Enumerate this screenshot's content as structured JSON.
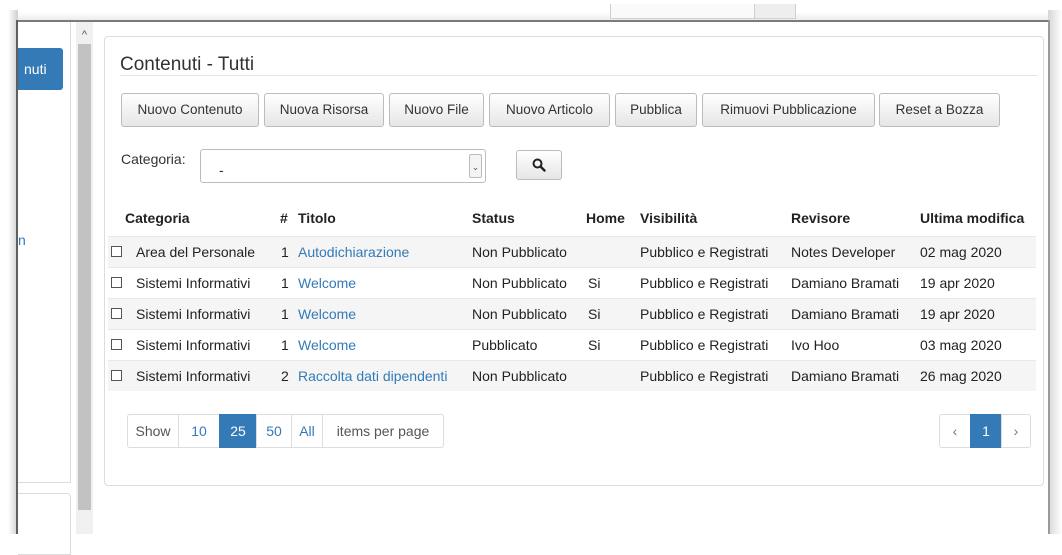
{
  "sidebar": {
    "active_item": "nuti",
    "link_fragment": "n"
  },
  "page": {
    "title": "Contenuti - Tutti"
  },
  "toolbar": {
    "buttons": [
      "Nuovo Contenuto",
      "Nuova Risorsa",
      "Nuovo File",
      "Nuovo Articolo",
      "Pubblica",
      "Rimuovi Pubblicazione",
      "Reset a Bozza"
    ]
  },
  "filter": {
    "label": "Categoria:",
    "selected": "-",
    "search_icon": "search-icon"
  },
  "table": {
    "headers": [
      "Categoria",
      "#",
      "Titolo",
      "Status",
      "Home",
      "Visibilità",
      "Revisore",
      "Ultima modifica"
    ],
    "rows": [
      [
        "Area del Personale",
        "1",
        "Autodichiarazione",
        "Non Pubblicato",
        "",
        "Pubblico e Registrati",
        "Notes Developer",
        "02 mag 2020"
      ],
      [
        "Sistemi Informativi",
        "1",
        "Welcome",
        "Non Pubblicato",
        "Si",
        "Pubblico e Registrati",
        "Damiano Bramati",
        "19 apr 2020"
      ],
      [
        "Sistemi Informativi",
        "1",
        "Welcome",
        "Non Pubblicato",
        "Si",
        "Pubblico e Registrati",
        "Damiano Bramati",
        "19 apr 2020"
      ],
      [
        "Sistemi Informativi",
        "1",
        "Welcome",
        "Pubblicato",
        "Si",
        "Pubblico e Registrati",
        "Ivo Hoo",
        "03 mag 2020"
      ],
      [
        "Sistemi Informativi",
        "2",
        "Raccolta dati dipendenti",
        "Non Pubblicato",
        "",
        "Pubblico e Registrati",
        "Damiano Bramati",
        "26 mag 2020"
      ]
    ]
  },
  "page_size": {
    "show_label": "Show",
    "options": [
      "10",
      "25",
      "50",
      "All"
    ],
    "selected": "25",
    "suffix": "items per page"
  },
  "pagination": {
    "prev": "‹",
    "current": "1",
    "next": "›"
  },
  "colors": {
    "accent": "#337ab7",
    "link": "#337ab7"
  }
}
